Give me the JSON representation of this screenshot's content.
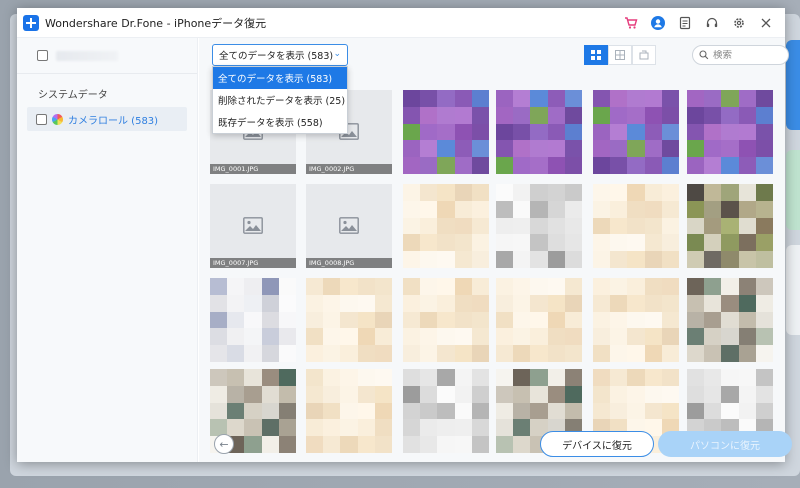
{
  "window": {
    "title": "Wondershare Dr.Fone - iPhoneデータ復元"
  },
  "sidebar": {
    "section_title": "システムデータ",
    "items": [
      {
        "label": "カメラロール (583)"
      }
    ]
  },
  "filter": {
    "selected": "全てのデータを表示 (583)",
    "options": [
      "全てのデータを表示 (583)",
      "削除されたデータを表示 (25)",
      "既存データを表示 (558)"
    ]
  },
  "search": {
    "placeholder": "検索"
  },
  "thumbnails": {
    "row1": [
      {
        "caption": "IMG_0001.JPG"
      },
      {
        "caption": "IMG_0002.JPG"
      }
    ],
    "row2": [
      {
        "caption": "IMG_0007.JPG"
      },
      {
        "caption": "IMG_0008.JPG"
      }
    ]
  },
  "footer": {
    "restore_device": "デバイスに復元",
    "restore_pc": "パソコンに復元"
  },
  "colors": {
    "accent": "#1e79e6",
    "disabled_button": "#a9d3f8"
  },
  "icons": [
    "cart-icon",
    "user-icon",
    "document-icon",
    "headset-icon",
    "gear-icon",
    "close-icon",
    "search-icon",
    "back-arrow-icon",
    "image-placeholder-icon"
  ]
}
